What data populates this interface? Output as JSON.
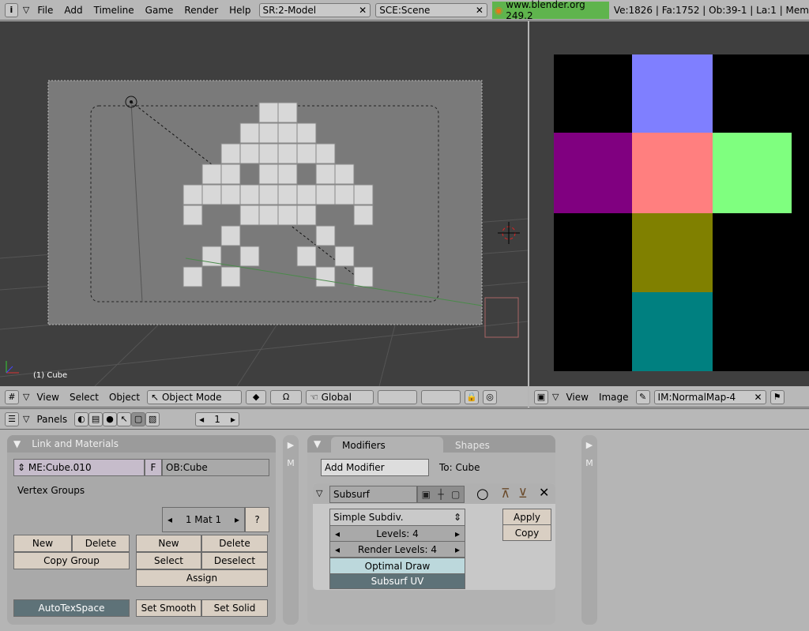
{
  "top": {
    "menu": [
      "File",
      "Add",
      "Timeline",
      "Game",
      "Render",
      "Help"
    ],
    "screen": "SR:2-Model",
    "scene": "SCE:Scene",
    "url": "www.blender.org 249.2",
    "stats": "Ve:1826 | Fa:1752 | Ob:39-1 | La:1  | Mem"
  },
  "viewport": {
    "label": "(1) Cube",
    "menu": [
      "View",
      "Select",
      "Object"
    ],
    "mode": "Object Mode",
    "orientation": "Global"
  },
  "image_editor": {
    "menu": [
      "View",
      "Image"
    ],
    "image": "IM:NormalMap-4",
    "colors": {
      "top": "#7f7fff",
      "left": "#800080",
      "center": "#ff7f7f",
      "right": "#7fff7f",
      "lower": "#808000",
      "bottom": "#008080"
    }
  },
  "buttons": {
    "panels_label": "Panels",
    "frame": "1",
    "link": {
      "title": "Link and Materials",
      "mesh": "ME:Cube.010",
      "f": "F",
      "object": "OB:Cube",
      "vertex_groups": "Vertex Groups",
      "mat": "1 Mat 1",
      "q": "?",
      "vg_new": "New",
      "vg_delete": "Delete",
      "copy_group": "Copy Group",
      "new": "New",
      "delete": "Delete",
      "select": "Select",
      "deselect": "Deselect",
      "assign": "Assign",
      "autotex": "AutoTexSpace",
      "set_smooth": "Set Smooth",
      "set_solid": "Set Solid"
    },
    "side_m": "M",
    "modifiers": {
      "tab_active": "Modifiers",
      "tab_other": "Shapes",
      "add": "Add Modifier",
      "to": "To: Cube",
      "name": "Subsurf",
      "type": "Simple Subdiv.",
      "levels": "Levels: 4",
      "render_levels": "Render Levels: 4",
      "optimal": "Optimal Draw",
      "subsurf_uv": "Subsurf UV",
      "apply": "Apply",
      "copy": "Copy"
    }
  }
}
